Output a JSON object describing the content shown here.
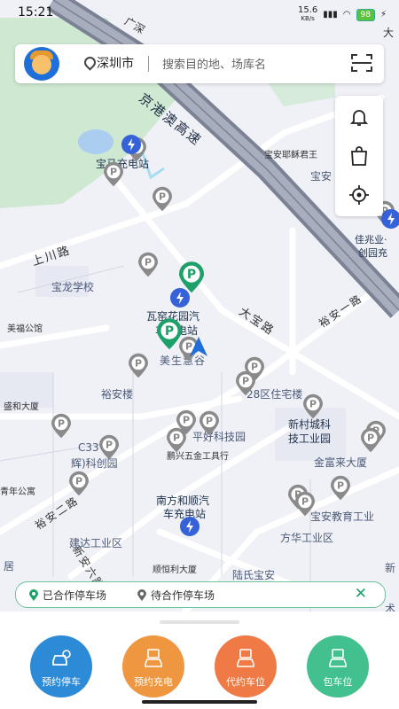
{
  "status_bar": {
    "time": "15:21",
    "network_speed": "15.6",
    "network_unit": "KB/s",
    "battery": "98"
  },
  "search": {
    "city": "深圳市",
    "placeholder": "搜索目的地、场库名"
  },
  "map": {
    "road_labels": [
      "京港澳高速",
      "上川路",
      "大宝路",
      "裕安一路",
      "裕安二路",
      "新安六路",
      "广深",
      "大"
    ],
    "place_labels": [
      "宝马充电站",
      "宝龙学校",
      "美福公馆",
      "盛和大厦",
      "青年公寓",
      "裕安楼",
      "瓦窑花园汽",
      "车充电站",
      "美生慧谷",
      "28区住宅楼",
      "新村城科",
      "技工业园",
      "平好科技园",
      "C33",
      "辉)科创园",
      "鹏兴五金工具行",
      "金富来大厦",
      "南方和顺汽",
      "车充电站",
      "宝安教育工业",
      "方华工业区",
      "建达工业区",
      "顺恒利大厦",
      "陆氏宝安",
      "宝安耶稣君王",
      "佳兆业·",
      "创园充",
      "宝安",
      "居",
      "新",
      "术"
    ]
  },
  "legend": {
    "cooperative": "已合作停车场",
    "pending": "待合作停车场"
  },
  "actions": [
    {
      "label": "预约停车",
      "color": "#2c8ad6"
    },
    {
      "label": "预约充电",
      "color": "#ef9641"
    },
    {
      "label": "代约车位",
      "color": "#ef7a45"
    },
    {
      "label": "包车位",
      "color": "#42c08d"
    }
  ],
  "colors": {
    "accent_green": "#1ea06a",
    "charger_blue": "#3561d9",
    "parking_gray": "#8a8a8a",
    "location_blue": "#1f6ed9"
  }
}
